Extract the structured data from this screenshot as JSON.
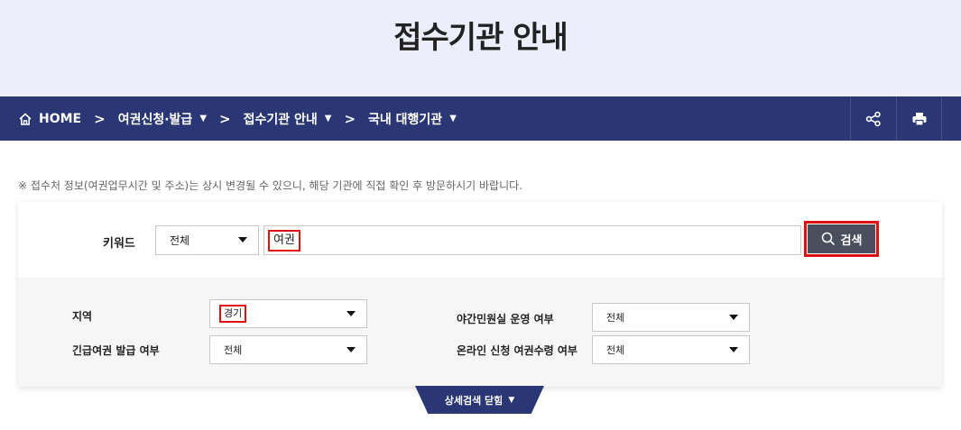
{
  "page": {
    "title": "접수기관 안내"
  },
  "nav": {
    "home": "HOME",
    "separator": ">",
    "crumbs": [
      {
        "label": "여권신청·발급"
      },
      {
        "label": "접수기관 안내"
      },
      {
        "label": "국내 대행기관"
      }
    ],
    "caret": "▼"
  },
  "notice": "※ 접수처 정보(여권업무시간 및 주소)는 상시 변경될 수 있으니, 해당 기관에 직접 확인 후 방문하시기 바랍니다.",
  "search": {
    "keyword_label": "키워드",
    "scope_value": "전체",
    "keyword_value": "여권",
    "button_label": "검색"
  },
  "detail": {
    "region_label": "지역",
    "region_value": "경기",
    "emergency_label": "긴급여권 발급 여부",
    "emergency_value": "전체",
    "night_label": "야간민원실 운영 여부",
    "night_value": "전체",
    "online_label": "온라인 신청 여권수령 여부",
    "online_value": "전체"
  },
  "toggle": {
    "label": "상세검색 닫힘",
    "caret": "▼"
  },
  "colors": {
    "navy": "#2b3674",
    "hero_bg": "#eceefb",
    "highlight": "#e01010",
    "button": "#4a4f5d"
  }
}
